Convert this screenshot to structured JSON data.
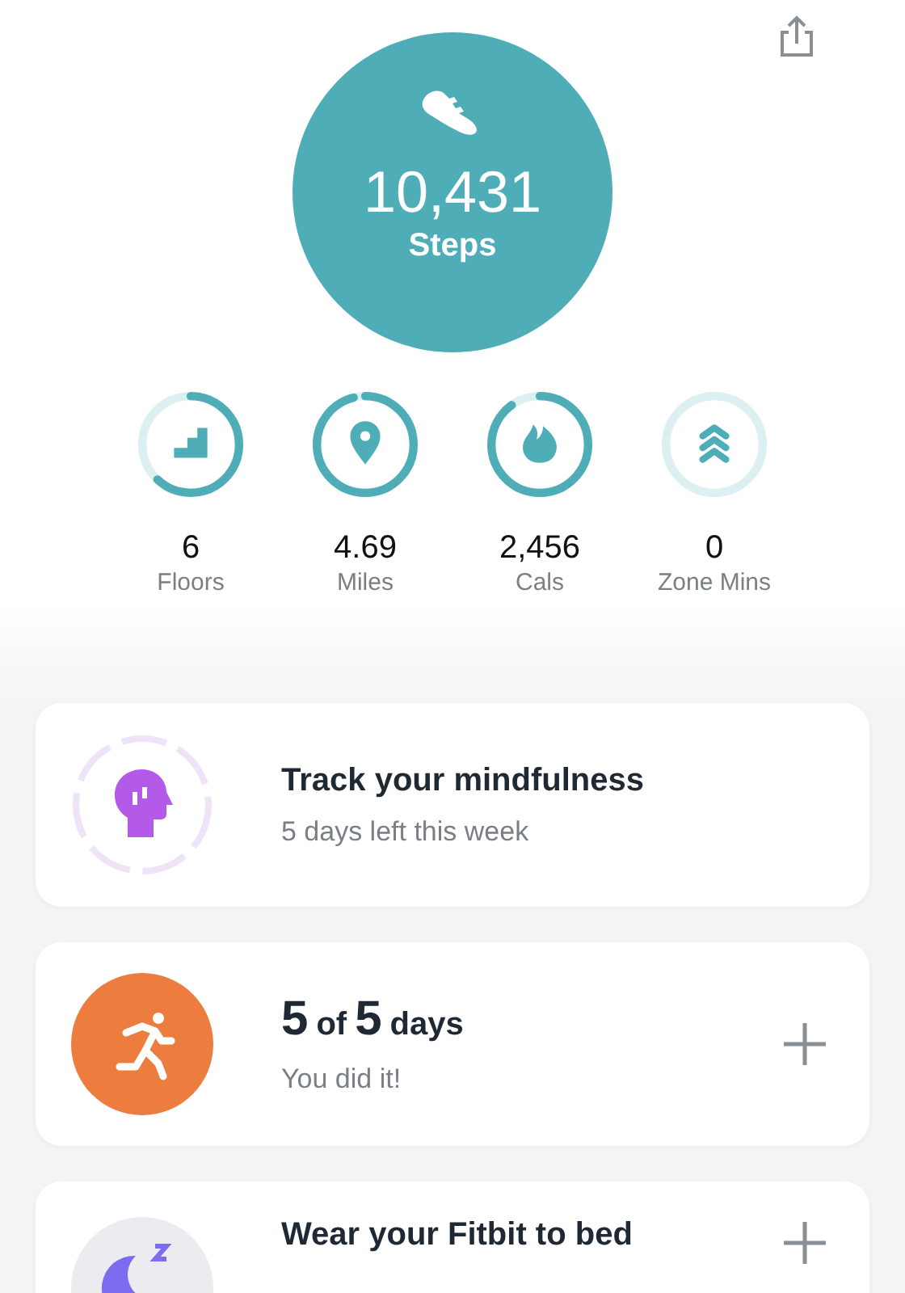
{
  "steps": {
    "value": "10,431",
    "label": "Steps"
  },
  "stats": [
    {
      "kind": "floors",
      "value": "6",
      "label": "Floors"
    },
    {
      "kind": "distance",
      "value": "4.69",
      "label": "Miles"
    },
    {
      "kind": "calories",
      "value": "2,456",
      "label": "Cals"
    },
    {
      "kind": "zone",
      "value": "0",
      "label": "Zone Mins"
    }
  ],
  "cards": [
    {
      "kind": "mindfulness",
      "title_parts": [
        {
          "text": "Track your mindfulness",
          "kind": "normal"
        }
      ],
      "subtitle": "5 days left this week",
      "add": false
    },
    {
      "kind": "exercise",
      "title_parts": [
        {
          "text": "5",
          "kind": "big"
        },
        {
          "text": "of",
          "kind": "normal"
        },
        {
          "text": "5",
          "kind": "big"
        },
        {
          "text": "days",
          "kind": "normal"
        }
      ],
      "subtitle": "You did it!",
      "add": true
    },
    {
      "kind": "sleep",
      "title_parts": [
        {
          "text": "Wear your Fitbit to bed",
          "kind": "normal"
        }
      ],
      "add": true
    }
  ]
}
